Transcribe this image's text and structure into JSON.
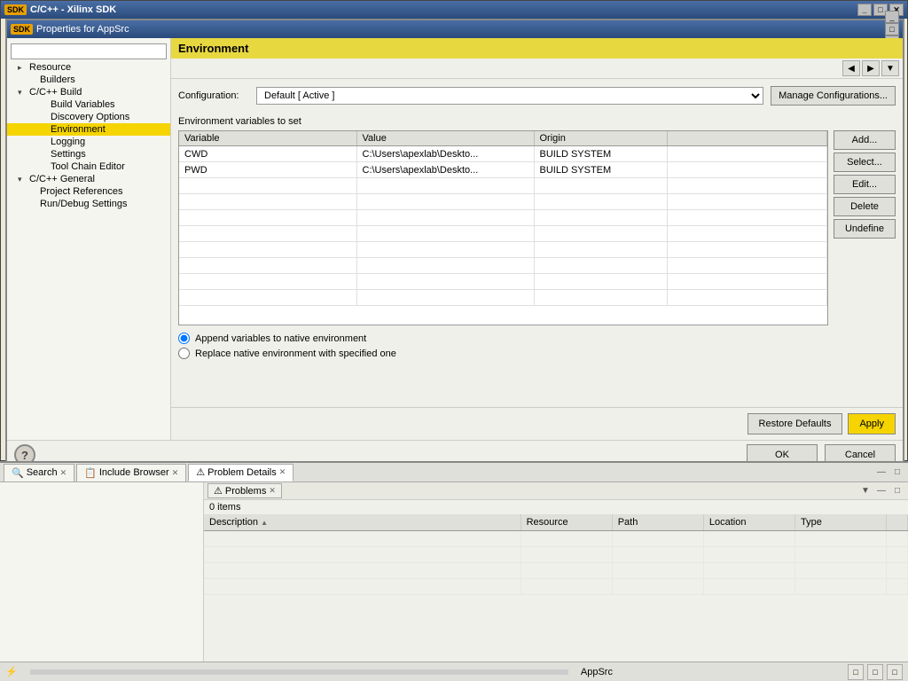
{
  "mainWindow": {
    "title": "C/C++ - Xilinx SDK",
    "badge": "SDK",
    "winControls": [
      "_",
      "□",
      "✕"
    ]
  },
  "propsWindow": {
    "title": "Properties for AppSrc",
    "badge": "SDK",
    "winControls": [
      "_",
      "□",
      "✕"
    ]
  },
  "panelHeader": "Environment",
  "navButtons": [
    "◀",
    "▶",
    "▼"
  ],
  "treeSearch": {
    "placeholder": ""
  },
  "treeItems": [
    {
      "label": "Resource",
      "indent": 1,
      "type": "parent",
      "expanded": true
    },
    {
      "label": "Builders",
      "indent": 2,
      "type": "leaf"
    },
    {
      "label": "C/C++ Build",
      "indent": 1,
      "type": "parent",
      "expanded": true,
      "selected": false
    },
    {
      "label": "Build Variables",
      "indent": 3,
      "type": "leaf"
    },
    {
      "label": "Discovery Options",
      "indent": 3,
      "type": "leaf"
    },
    {
      "label": "Environment",
      "indent": 3,
      "type": "leaf",
      "selected": true
    },
    {
      "label": "Logging",
      "indent": 3,
      "type": "leaf"
    },
    {
      "label": "Settings",
      "indent": 3,
      "type": "leaf"
    },
    {
      "label": "Tool Chain Editor",
      "indent": 3,
      "type": "leaf"
    },
    {
      "label": "C/C++ General",
      "indent": 1,
      "type": "parent",
      "expanded": true
    },
    {
      "label": "Project References",
      "indent": 2,
      "type": "leaf"
    },
    {
      "label": "Run/Debug Settings",
      "indent": 2,
      "type": "leaf"
    }
  ],
  "configuration": {
    "label": "Configuration:",
    "value": "Default  [ Active ]",
    "manageBtn": "Manage Configurations..."
  },
  "envVarsLabel": "Environment variables to set",
  "tableHeaders": [
    "Variable",
    "Value",
    "Origin",
    ""
  ],
  "tableRows": [
    {
      "variable": "CWD",
      "value": "C:\\Users\\apexlab\\Deskto...",
      "origin": "BUILD SYSTEM"
    },
    {
      "variable": "PWD",
      "value": "C:\\Users\\apexlab\\Deskto...",
      "origin": "BUILD SYSTEM"
    }
  ],
  "sideButtons": {
    "add": "Add...",
    "select": "Select...",
    "edit": "Edit...",
    "delete": "Delete",
    "undefine": "Undefine"
  },
  "radioOptions": {
    "append": "Append variables to native environment",
    "replace": "Replace native environment with specified one"
  },
  "bottomButtons": {
    "restoreDefaults": "Restore Defaults",
    "apply": "Apply"
  },
  "dialogButtons": {
    "ok": "OK",
    "cancel": "Cancel"
  },
  "helpIcon": "?",
  "bottomTabBar": {
    "tabs": [
      {
        "label": "Search",
        "icon": "🔍",
        "active": false,
        "closeable": true
      },
      {
        "label": "Include Browser",
        "icon": "📋",
        "active": false,
        "closeable": true
      },
      {
        "label": "Problem Details",
        "icon": "⚠",
        "active": true,
        "closeable": true
      }
    ],
    "winControls": [
      "—",
      "□"
    ]
  },
  "problemsPanel": {
    "tab": "Problems",
    "badge": "✕",
    "count": "0 items",
    "columns": [
      {
        "label": "Description",
        "sort": "▲"
      },
      {
        "label": "Resource"
      },
      {
        "label": "Path"
      },
      {
        "label": "Location"
      },
      {
        "label": "Type"
      },
      {
        "label": ""
      }
    ]
  },
  "statusBar": {
    "icon": "⚡",
    "appLabel": "AppSrc",
    "rightIcons": [
      "□",
      "□",
      "□"
    ]
  }
}
